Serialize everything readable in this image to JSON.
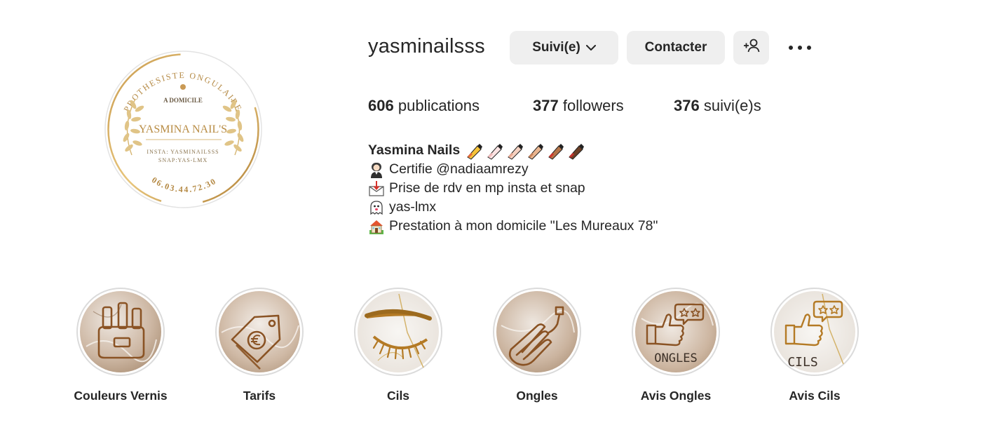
{
  "profile": {
    "username": "yasminailsss",
    "avatar_text": {
      "arc_top": "PROTHESISTE ONGULAIRE",
      "subtitle": "A DOMICILE",
      "name": "YASMINA NAIL'S",
      "insta": "INSTA: YASMINAILSSS",
      "snap": "SNAP:YAS-LMX",
      "phone": "06.03.44.72.30"
    }
  },
  "actions": {
    "follow_label": "Suivi(e)",
    "contact_label": "Contacter",
    "add_user_icon": "person-add-icon",
    "more_icon": "more-horizontal-icon"
  },
  "stats": {
    "posts_count": "606",
    "posts_label": "publications",
    "followers_count": "377",
    "followers_label": "followers",
    "following_count": "376",
    "following_label": "suivi(e)s"
  },
  "bio": {
    "name": "Yasmina Nails",
    "lines": [
      {
        "icon": "woman-graduate-icon",
        "text": "Certifie @nadiaamrezy"
      },
      {
        "icon": "envelope-arrow-icon",
        "text": "Prise de rdv en mp insta et snap"
      },
      {
        "icon": "ghost-icon",
        "text": "yas-lmx"
      },
      {
        "icon": "house-icon",
        "text": "Prestation à mon domicile \"Les Mureaux 78\""
      }
    ]
  },
  "highlights": [
    {
      "label": "Couleurs Vernis",
      "icon": "nail-polish-icon"
    },
    {
      "label": "Tarifs",
      "icon": "price-tag-icon"
    },
    {
      "label": "Cils",
      "icon": "eyelash-icon"
    },
    {
      "label": "Ongles",
      "icon": "nail-file-hand-icon"
    },
    {
      "label": "Avis Ongles",
      "icon": "thumbs-up-review-icon",
      "overlay_text": "ONGLES"
    },
    {
      "label": "Avis Cils",
      "icon": "thumbs-up-review-icon",
      "overlay_text": "CILS"
    }
  ],
  "colors": {
    "accent_gold": "#b8863a",
    "button_bg": "#efefef",
    "text": "#262626",
    "ring": "#dbdbdb"
  }
}
